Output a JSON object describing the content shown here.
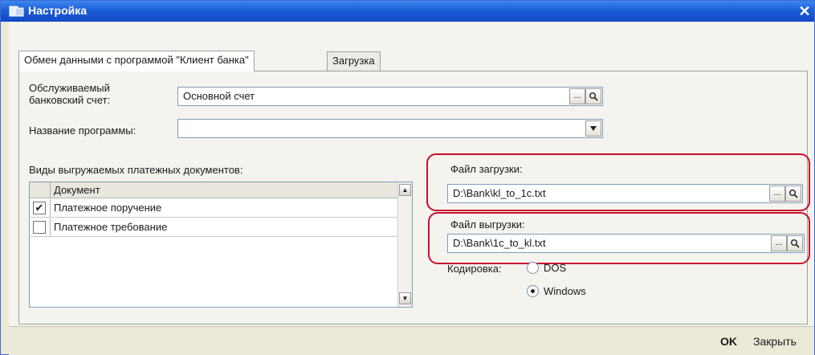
{
  "window": {
    "title": "Настройка"
  },
  "tabs": [
    {
      "label": "Обмен данными с программой \"Клиент банка\"",
      "active": true
    },
    {
      "label": "Загрузка",
      "active": false
    }
  ],
  "account": {
    "label": "Обслуживаемый банковский счет:",
    "value": "Основной счет",
    "ellipsis": "...",
    "search_icon": "magnifier-icon"
  },
  "program": {
    "label": "Название программы:",
    "value": ""
  },
  "documents": {
    "label": "Виды выгружаемых платежных документов:",
    "column": "Документ",
    "rows": [
      {
        "name": "Платежное поручение",
        "checked": true
      },
      {
        "name": "Платежное требование",
        "checked": false
      }
    ]
  },
  "import_file": {
    "label": "Файл загрузки:",
    "value": "D:\\Bank\\kl_to_1c.txt",
    "ellipsis": "..."
  },
  "export_file": {
    "label": "Файл выгрузки:",
    "value": "D:\\Bank\\1c_to_kl.txt",
    "ellipsis": "..."
  },
  "encoding": {
    "label": "Кодировка:",
    "options": [
      "DOS",
      "Windows"
    ],
    "selected": "Windows"
  },
  "footer": {
    "ok": "OK",
    "close": "Закрыть"
  },
  "colors": {
    "title_bar": "#1d5fd6",
    "highlight": "#c8102e"
  }
}
